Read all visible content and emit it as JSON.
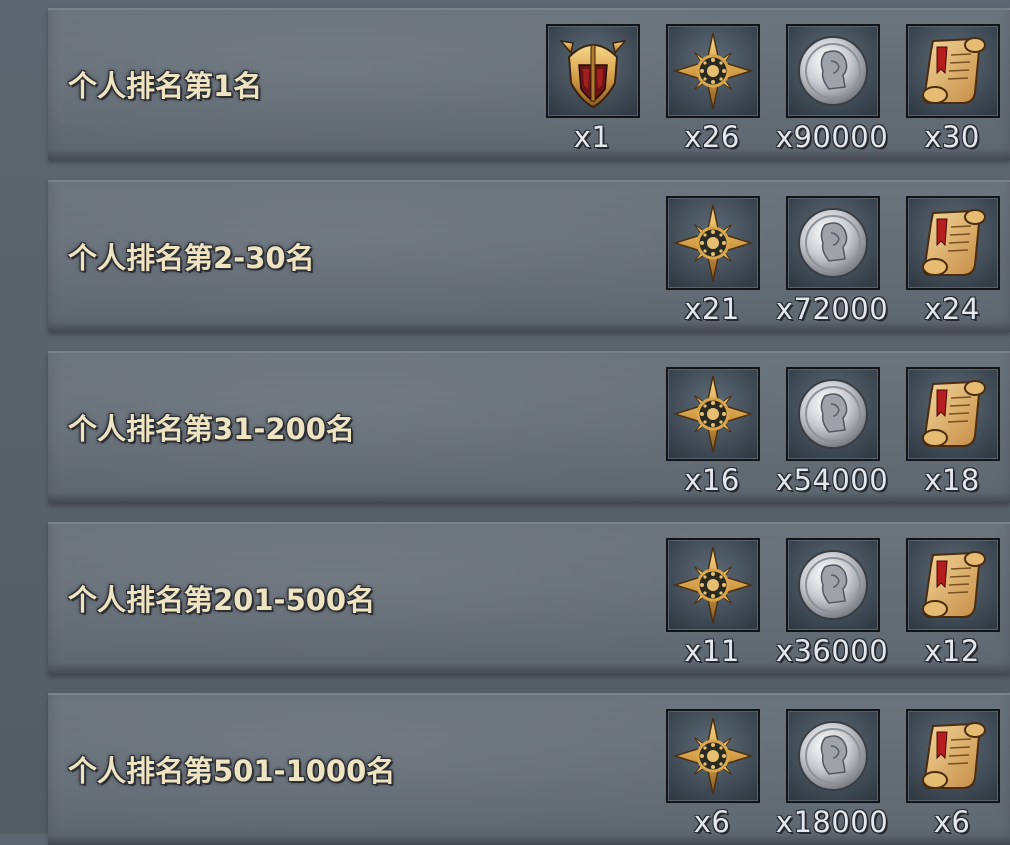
{
  "rows": [
    {
      "title": "个人排名第1名",
      "rewards": [
        {
          "icon": "helmet-icon",
          "count": "x1"
        },
        {
          "icon": "golden-star-icon",
          "count": "x26"
        },
        {
          "icon": "silver-coin-icon",
          "count": "x90000"
        },
        {
          "icon": "scroll-icon",
          "count": "x30"
        }
      ]
    },
    {
      "title": "个人排名第2-30名",
      "rewards": [
        {
          "icon": "golden-star-icon",
          "count": "x21"
        },
        {
          "icon": "silver-coin-icon",
          "count": "x72000"
        },
        {
          "icon": "scroll-icon",
          "count": "x24"
        }
      ]
    },
    {
      "title": "个人排名第31-200名",
      "rewards": [
        {
          "icon": "golden-star-icon",
          "count": "x16"
        },
        {
          "icon": "silver-coin-icon",
          "count": "x54000"
        },
        {
          "icon": "scroll-icon",
          "count": "x18"
        }
      ]
    },
    {
      "title": "个人排名第201-500名",
      "rewards": [
        {
          "icon": "golden-star-icon",
          "count": "x11"
        },
        {
          "icon": "silver-coin-icon",
          "count": "x36000"
        },
        {
          "icon": "scroll-icon",
          "count": "x12"
        }
      ]
    },
    {
      "title": "个人排名第501-1000名",
      "rewards": [
        {
          "icon": "golden-star-icon",
          "count": "x6"
        },
        {
          "icon": "silver-coin-icon",
          "count": "x18000"
        },
        {
          "icon": "scroll-icon",
          "count": "x6"
        }
      ]
    }
  ],
  "colors": {
    "title_text": "#efe4c2",
    "count_text": "#e3e8ee",
    "panel": "#666e78",
    "background": "#596169"
  }
}
